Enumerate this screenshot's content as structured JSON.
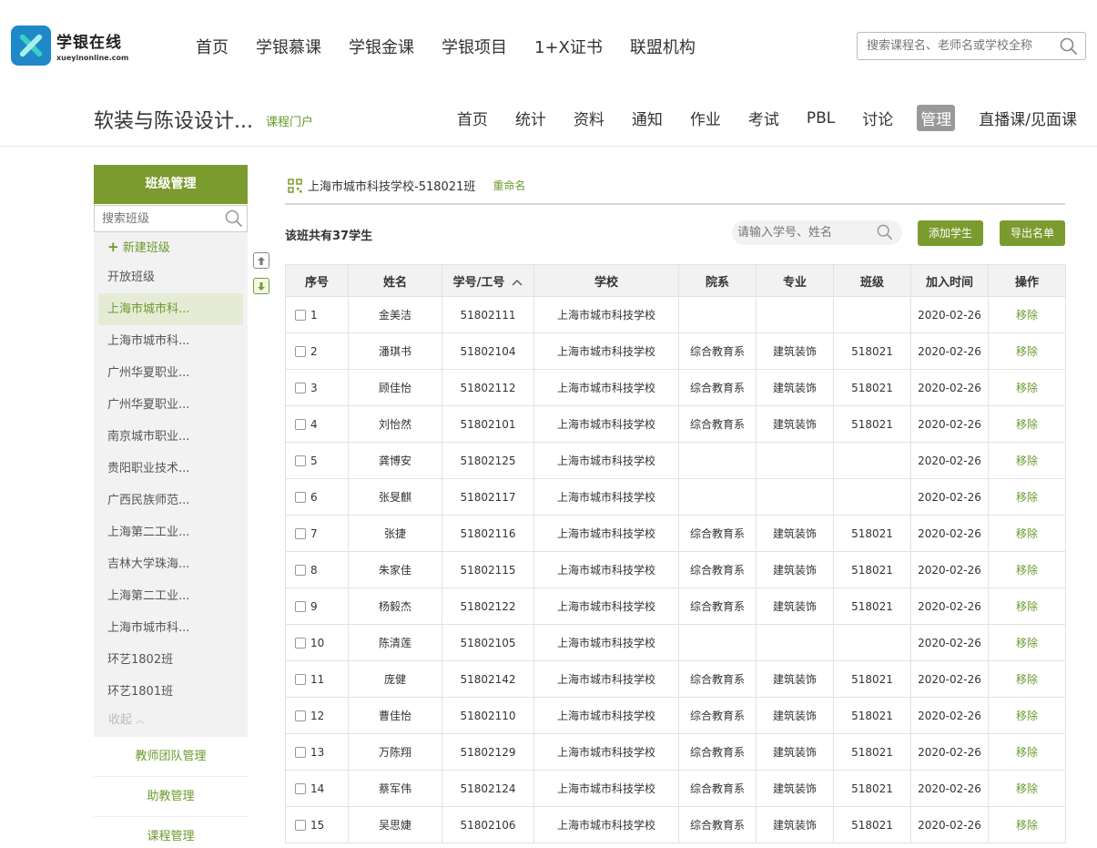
{
  "site": {
    "logo_title": "学银在线",
    "logo_sub": "xueyinonline.com"
  },
  "mainnav": [
    "首页",
    "学银慕课",
    "学银金课",
    "学银项目",
    "1+X证书",
    "联盟机构"
  ],
  "topsearch": {
    "placeholder": "搜索课程名、老师名或学校全称"
  },
  "course": {
    "title": "软装与陈设设计...",
    "portal": "课程门户",
    "nav": [
      "首页",
      "统计",
      "资料",
      "通知",
      "作业",
      "考试",
      "PBL",
      "讨论",
      "管理",
      "直播课/见面课"
    ],
    "active_nav": "管理"
  },
  "sidebar": {
    "head": "班级管理",
    "search_placeholder": "搜索班级",
    "new_class": "新建班级",
    "classes": [
      "开放班级",
      "上海市城市科...",
      "上海市城市科...",
      "广州华夏职业...",
      "广州华夏职业...",
      "南京城市职业...",
      "贵阳职业技术...",
      "广西民族师范...",
      "上海第二工业...",
      "吉林大学珠海...",
      "上海第二工业...",
      "上海市城市科...",
      "环艺1802班",
      "环艺1801班"
    ],
    "active_index": 1,
    "collapse": "收起",
    "links": [
      "教师团队管理",
      "助教管理",
      "课程管理"
    ]
  },
  "panel": {
    "class_name": "上海市城市科技学校-518021班",
    "rename": "重命名",
    "count_text": "该班共有37学生",
    "search_placeholder": "请输入学号、姓名",
    "add_student": "添加学生",
    "export_list": "导出名单"
  },
  "table": {
    "headers": [
      "序号",
      "姓名",
      "学号/工号",
      "学校",
      "院系",
      "专业",
      "班级",
      "加入时间",
      "操作"
    ],
    "sort_column": "学号/工号",
    "action_label": "移除",
    "rows": [
      {
        "idx": "1",
        "name": "金美洁",
        "id": "51802111",
        "school": "上海市城市科技学校",
        "dept": "",
        "major": "",
        "cls": "",
        "date": "2020-02-26"
      },
      {
        "idx": "2",
        "name": "潘琪书",
        "id": "51802104",
        "school": "上海市城市科技学校",
        "dept": "综合教育系",
        "major": "建筑装饰",
        "cls": "518021",
        "date": "2020-02-26"
      },
      {
        "idx": "3",
        "name": "顾佳怡",
        "id": "51802112",
        "school": "上海市城市科技学校",
        "dept": "综合教育系",
        "major": "建筑装饰",
        "cls": "518021",
        "date": "2020-02-26"
      },
      {
        "idx": "4",
        "name": "刘怡然",
        "id": "51802101",
        "school": "上海市城市科技学校",
        "dept": "综合教育系",
        "major": "建筑装饰",
        "cls": "518021",
        "date": "2020-02-26"
      },
      {
        "idx": "5",
        "name": "龚博安",
        "id": "51802125",
        "school": "上海市城市科技学校",
        "dept": "",
        "major": "",
        "cls": "",
        "date": "2020-02-26"
      },
      {
        "idx": "6",
        "name": "张旻麒",
        "id": "51802117",
        "school": "上海市城市科技学校",
        "dept": "",
        "major": "",
        "cls": "",
        "date": "2020-02-26"
      },
      {
        "idx": "7",
        "name": "张捷",
        "id": "51802116",
        "school": "上海市城市科技学校",
        "dept": "综合教育系",
        "major": "建筑装饰",
        "cls": "518021",
        "date": "2020-02-26"
      },
      {
        "idx": "8",
        "name": "朱家佳",
        "id": "51802115",
        "school": "上海市城市科技学校",
        "dept": "综合教育系",
        "major": "建筑装饰",
        "cls": "518021",
        "date": "2020-02-26"
      },
      {
        "idx": "9",
        "name": "杨毅杰",
        "id": "51802122",
        "school": "上海市城市科技学校",
        "dept": "综合教育系",
        "major": "建筑装饰",
        "cls": "518021",
        "date": "2020-02-26"
      },
      {
        "idx": "10",
        "name": "陈清莲",
        "id": "51802105",
        "school": "上海市城市科技学校",
        "dept": "",
        "major": "",
        "cls": "",
        "date": "2020-02-26"
      },
      {
        "idx": "11",
        "name": "庞健",
        "id": "51802142",
        "school": "上海市城市科技学校",
        "dept": "综合教育系",
        "major": "建筑装饰",
        "cls": "518021",
        "date": "2020-02-26"
      },
      {
        "idx": "12",
        "name": "曹佳怡",
        "id": "51802110",
        "school": "上海市城市科技学校",
        "dept": "综合教育系",
        "major": "建筑装饰",
        "cls": "518021",
        "date": "2020-02-26"
      },
      {
        "idx": "13",
        "name": "万陈翔",
        "id": "51802129",
        "school": "上海市城市科技学校",
        "dept": "综合教育系",
        "major": "建筑装饰",
        "cls": "518021",
        "date": "2020-02-26"
      },
      {
        "idx": "14",
        "name": "蔡军伟",
        "id": "51802124",
        "school": "上海市城市科技学校",
        "dept": "综合教育系",
        "major": "建筑装饰",
        "cls": "518021",
        "date": "2020-02-26"
      },
      {
        "idx": "15",
        "name": "吴思婕",
        "id": "51802106",
        "school": "上海市城市科技学校",
        "dept": "综合教育系",
        "major": "建筑装饰",
        "cls": "518021",
        "date": "2020-02-26"
      }
    ]
  },
  "colors": {
    "accent": "#7b9b2f",
    "link": "#6a9a2e",
    "active_nav_bg": "#999999",
    "logo_blue": "#1e88c9"
  },
  "icons": {
    "search": "search-icon",
    "qr": "qr-icon",
    "up": "arrow-up-icon",
    "down": "arrow-down-icon",
    "plus": "plus-icon",
    "sort": "sort-up-icon",
    "collapse": "chevron-up-icon"
  }
}
